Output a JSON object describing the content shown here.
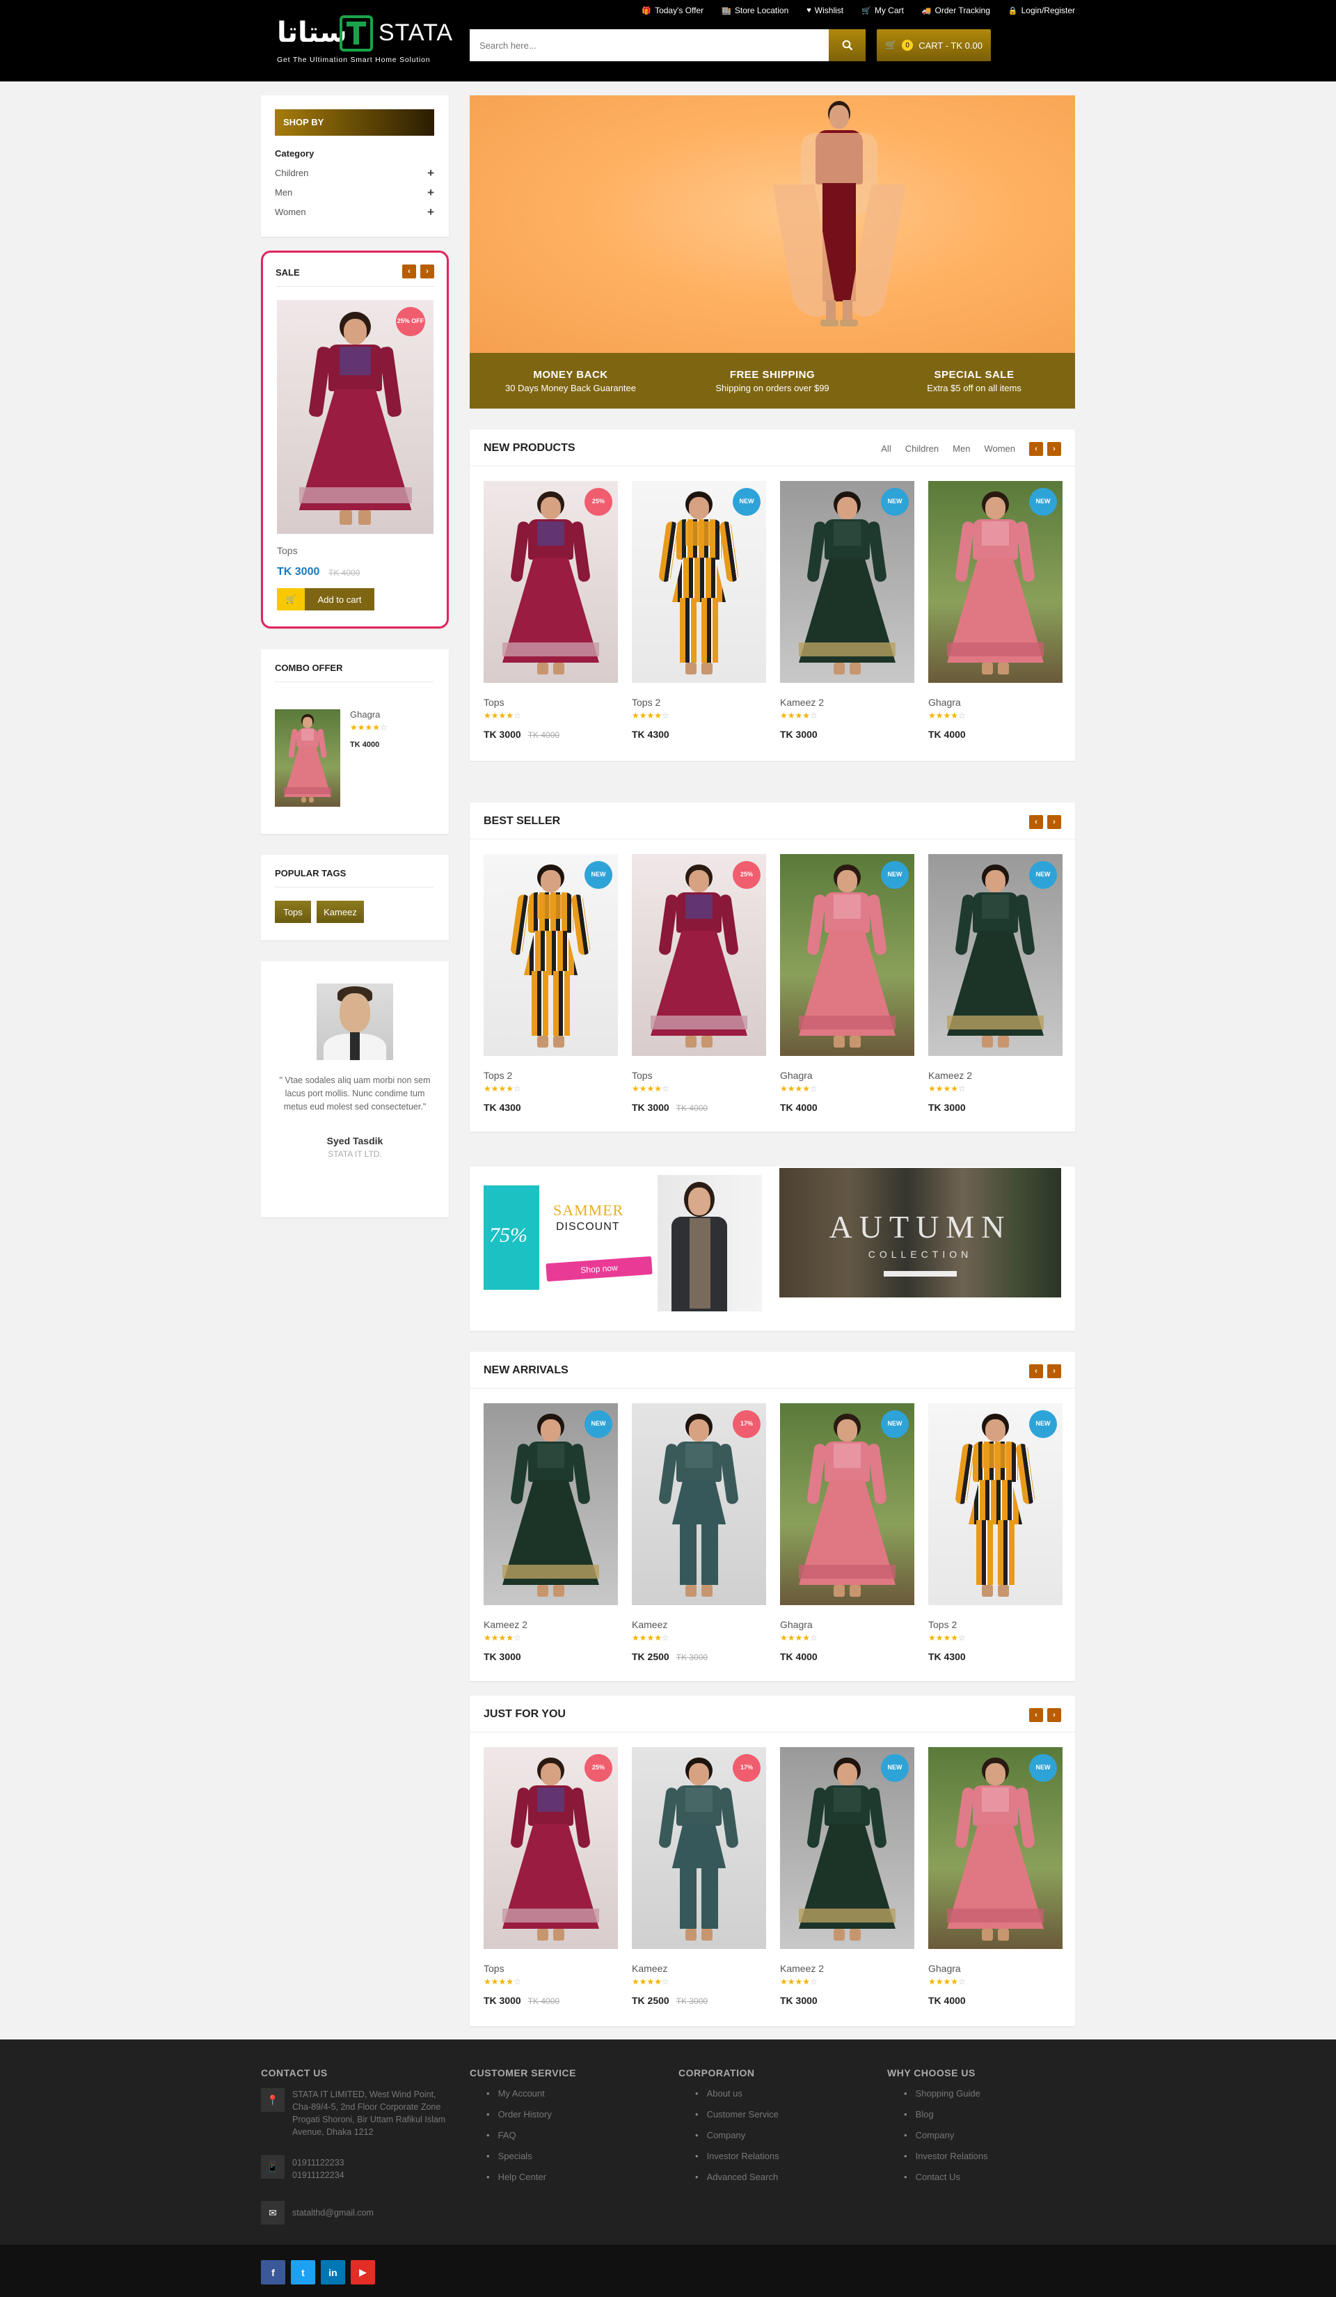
{
  "header": {
    "toplinks": [
      {
        "icon": "gift-icon",
        "glyph": "🎁",
        "label": "Today's Offer"
      },
      {
        "icon": "store-icon",
        "glyph": "🏬",
        "label": "Store Location"
      },
      {
        "icon": "heart-icon",
        "glyph": "♥",
        "label": "Wishlist"
      },
      {
        "icon": "cart-icon",
        "glyph": "🛒",
        "label": "My Cart"
      },
      {
        "icon": "truck-icon",
        "glyph": "🚚",
        "label": "Order Tracking"
      },
      {
        "icon": "lock-icon",
        "glyph": "🔒",
        "label": "Login/Register"
      }
    ],
    "logo_arabic": "ستاتا",
    "logo_brand": "STATA",
    "logo_tagline": "Get The Ultimation Smart Home Solution",
    "search_placeholder": "Search here...",
    "cart_count": "0",
    "cart_label": "CART - TK 0.00"
  },
  "sidebar": {
    "shopby_title": "SHOP BY",
    "category_title": "Category",
    "categories": [
      "Children",
      "Men",
      "Women"
    ],
    "sale": {
      "title": "SALE",
      "badge": "25% OFF",
      "product_name": "Tops",
      "price": "TK 3000",
      "old_price": "TK 4000",
      "add_to_cart": "Add to cart"
    },
    "combo": {
      "title": "COMBO OFFER",
      "product_name": "Ghagra",
      "rating": 4,
      "price": "TK 4000"
    },
    "tags": {
      "title": "POPULAR TAGS",
      "items": [
        "Tops",
        "Kameez"
      ]
    },
    "testimonial": {
      "quote": "\" Vtae sodales aliq uam morbi non sem lacus port mollis. Nunc condime tum metus eud molest sed consectetuer.\"",
      "name": "Syed Tasdik",
      "company": "STATA IT LTD."
    }
  },
  "banner": {
    "features": [
      {
        "title": "MONEY BACK",
        "text": "30 Days Money Back Guarantee"
      },
      {
        "title": "FREE SHIPPING",
        "text": "Shipping on orders over $99"
      },
      {
        "title": "SPECIAL SALE",
        "text": "Extra $5 off on all items"
      }
    ]
  },
  "new_products": {
    "title": "NEW PRODUCTS",
    "filters": [
      "All",
      "Children",
      "Men",
      "Women"
    ],
    "items": [
      {
        "name": "Tops",
        "price": "TK 3000",
        "old": "TK 4000",
        "badge": "25%",
        "type": "off",
        "img": "maroon"
      },
      {
        "name": "Tops 2",
        "price": "TK 4300",
        "old": "",
        "badge": "NEW",
        "type": "new",
        "img": "stripe"
      },
      {
        "name": "Kameez 2",
        "price": "TK 3000",
        "old": "",
        "badge": "NEW",
        "type": "new",
        "img": "green"
      },
      {
        "name": "Ghagra",
        "price": "TK 4000",
        "old": "",
        "badge": "NEW",
        "type": "new",
        "img": "pink"
      }
    ]
  },
  "best_seller": {
    "title": "BEST SELLER",
    "items": [
      {
        "name": "Tops 2",
        "price": "TK 4300",
        "old": "",
        "badge": "NEW",
        "type": "new",
        "img": "stripe"
      },
      {
        "name": "Tops",
        "price": "TK 3000",
        "old": "TK 4000",
        "badge": "25%",
        "type": "off",
        "img": "maroon"
      },
      {
        "name": "Ghagra",
        "price": "TK 4000",
        "old": "",
        "badge": "NEW",
        "type": "new",
        "img": "pink"
      },
      {
        "name": "Kameez 2",
        "price": "TK 3000",
        "old": "",
        "badge": "NEW",
        "type": "new",
        "img": "green"
      }
    ]
  },
  "promo": {
    "left_percent": "75%",
    "left_title": "SAMMER",
    "left_sub": "DISCOUNT",
    "left_btn": "Shop now",
    "right_title": "AUTUMN",
    "right_sub": "COLLECTION"
  },
  "new_arrivals": {
    "title": "NEW ARRIVALS",
    "items": [
      {
        "name": "Kameez 2",
        "price": "TK 3000",
        "old": "",
        "badge": "NEW",
        "type": "new",
        "img": "green"
      },
      {
        "name": "Kameez",
        "price": "TK 2500",
        "old": "TK 3000",
        "badge": "17%",
        "type": "off",
        "img": "teal"
      },
      {
        "name": "Ghagra",
        "price": "TK 4000",
        "old": "",
        "badge": "NEW",
        "type": "new",
        "img": "pink"
      },
      {
        "name": "Tops 2",
        "price": "TK 4300",
        "old": "",
        "badge": "NEW",
        "type": "new",
        "img": "stripe"
      }
    ]
  },
  "just_for_you": {
    "title": "JUST FOR YOU",
    "items": [
      {
        "name": "Tops",
        "price": "TK 3000",
        "old": "TK 4000",
        "badge": "25%",
        "type": "off",
        "img": "maroon"
      },
      {
        "name": "Kameez",
        "price": "TK 2500",
        "old": "TK 3000",
        "badge": "17%",
        "type": "off",
        "img": "teal"
      },
      {
        "name": "Kameez 2",
        "price": "TK 3000",
        "old": "",
        "badge": "NEW",
        "type": "new",
        "img": "green"
      },
      {
        "name": "Ghagra",
        "price": "TK 4000",
        "old": "",
        "badge": "NEW",
        "type": "new",
        "img": "pink"
      }
    ]
  },
  "footer": {
    "contact_title": "CONTACT US",
    "address": "STATA IT LIMITED, West Wind Point, Cha-89/4-5, 2nd Floor Corporate Zone Progati Shoroni, Bir Uttam Rafikul Islam Avenue, Dhaka 1212",
    "phone1": "01911122233",
    "phone2": "01911122234",
    "email": "statalthd@gmail.com",
    "columns": [
      {
        "title": "CUSTOMER SERVICE",
        "links": [
          "My Account",
          "Order History",
          "FAQ",
          "Specials",
          "Help Center"
        ]
      },
      {
        "title": "CORPORATION",
        "links": [
          "About us",
          "Customer Service",
          "Company",
          "Investor Relations",
          "Advanced Search"
        ]
      },
      {
        "title": "WHY CHOOSE US",
        "links": [
          "Shopping Guide",
          "Blog",
          "Company",
          "Investor Relations",
          "Contact Us"
        ]
      }
    ],
    "social": [
      {
        "icon": "facebook-icon",
        "glyph": "f",
        "color": "#3b5998"
      },
      {
        "icon": "twitter-icon",
        "glyph": "t",
        "color": "#1da1f2"
      },
      {
        "icon": "linkedin-icon",
        "glyph": "in",
        "color": "#0077b5"
      },
      {
        "icon": "youtube-icon",
        "glyph": "▶",
        "color": "#e52d27"
      }
    ]
  },
  "colors": {
    "accent_gold": "#a67c0a",
    "nav_orange": "#b85e00",
    "sale_border": "#e0245e",
    "price_blue": "#1a7ac0",
    "olive_bar": "#7e6512"
  }
}
